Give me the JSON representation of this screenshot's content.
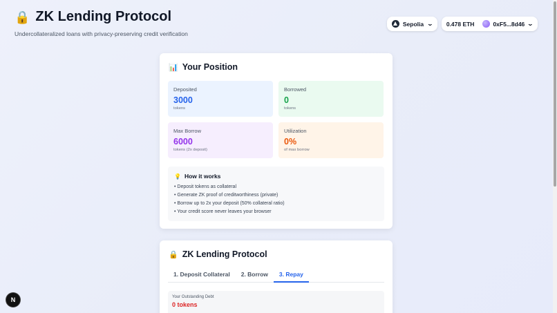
{
  "app": {
    "icon": "lock-icon",
    "title": "ZK Lending Protocol",
    "subtitle": "Undercollateralized loans with privacy-preserving credit verification"
  },
  "wallet": {
    "network": "Sepolia",
    "network_icon": "ethereum-icon",
    "balance": "0.478 ETH",
    "address": "0xF5...8d46"
  },
  "position": {
    "icon": "bar-chart-icon",
    "title": "Your Position",
    "stats": [
      {
        "label": "Deposited",
        "value": "3000",
        "sub": "tokens",
        "color": "#2563eb"
      },
      {
        "label": "Borrowed",
        "value": "0",
        "sub": "tokens",
        "color": "#16a34a"
      },
      {
        "label": "Max Borrow",
        "value": "6000",
        "sub": "tokens (2x deposit)",
        "color": "#9333ea"
      },
      {
        "label": "Utilization",
        "value": "0%",
        "sub": "of max borrow",
        "color": "#ea580c"
      }
    ]
  },
  "how_it_works": {
    "icon": "lightbulb-icon",
    "title": "How it works",
    "items": [
      "• Deposit tokens as collateral",
      "• Generate ZK proof of creditworthiness (private)",
      "• Borrow up to 2x your deposit (50% collateral ratio)",
      "• Your credit score never leaves your browser"
    ]
  },
  "protocol": {
    "icon": "lock-icon",
    "title": "ZK Lending Protocol",
    "tabs": [
      "1. Deposit Collateral",
      "2. Borrow",
      "3. Repay"
    ],
    "active_tab": 2,
    "debt_label": "Your Outstanding Debt",
    "debt_value": "0 tokens"
  },
  "badge": {
    "label": "N"
  }
}
